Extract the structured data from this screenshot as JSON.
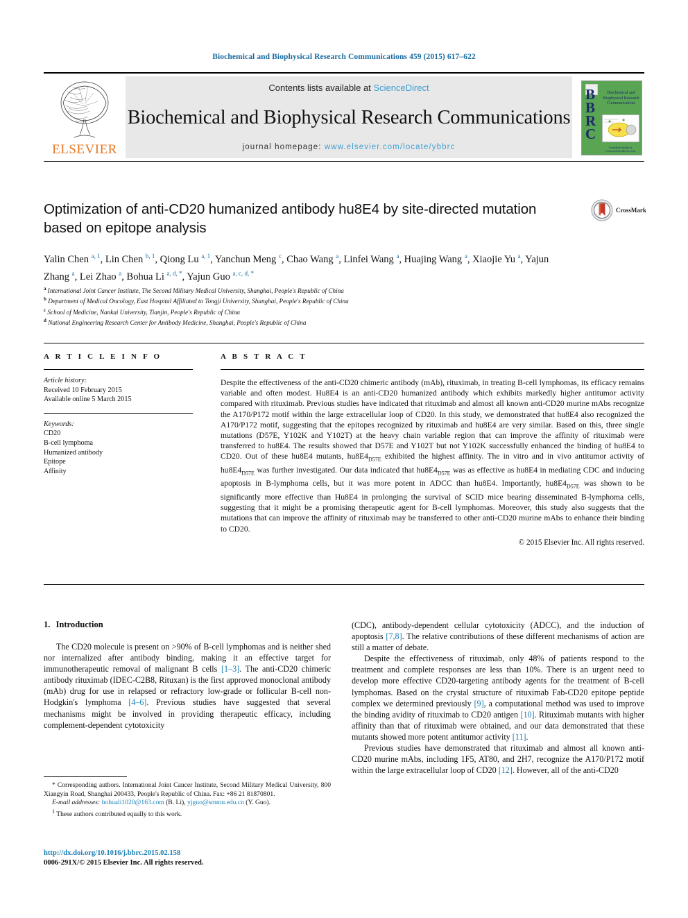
{
  "running_head": "Biochemical and Biophysical Research Communications 459 (2015) 617–622",
  "masthead": {
    "publisher": "ELSEVIER",
    "contents_prefix": "Contents lists available at ",
    "contents_link": "ScienceDirect",
    "journal_title": "Biochemical and Biophysical Research Communications",
    "homepage_prefix": "journal homepage: ",
    "homepage_url": "www.elsevier.com/locate/ybbrc",
    "cover": {
      "letters": "BBRC",
      "journal_name": "Biochemical and Biophysical Research Communications",
      "footer": "Available online at www.sciencedirect.com"
    }
  },
  "article": {
    "title": "Optimization of anti-CD20 humanized antibody hu8E4 by site-directed mutation based on epitope analysis",
    "crossmark_label": "CrossMark",
    "authors": [
      {
        "name": "Yalin Chen",
        "marks": "a, 1",
        "sep": ", "
      },
      {
        "name": "Lin Chen",
        "marks": "b, 1",
        "sep": ", "
      },
      {
        "name": "Qiong Lu",
        "marks": "a, 1",
        "sep": ", "
      },
      {
        "name": "Yanchun Meng",
        "marks": "c",
        "sep": ", "
      },
      {
        "name": "Chao Wang",
        "marks": "a",
        "sep": ", "
      },
      {
        "name": "Linfei Wang",
        "marks": "a",
        "sep": ", "
      },
      {
        "name": "Huajing Wang",
        "marks": "a",
        "sep": ", "
      },
      {
        "name": "Xiaojie Yu",
        "marks": "a",
        "sep": ", "
      },
      {
        "name": "Yajun Zhang",
        "marks": "a",
        "sep": ", "
      },
      {
        "name": "Lei Zhao",
        "marks": "a",
        "sep": ", "
      },
      {
        "name": "Bohua Li",
        "marks": "a, d, *",
        "sep": ", "
      },
      {
        "name": "Yajun Guo",
        "marks": "a, c, d, *",
        "sep": ""
      }
    ],
    "affiliations": [
      {
        "mark": "a",
        "text": "International Joint Cancer Institute, The Second Military Medical University, Shanghai, People's Republic of China"
      },
      {
        "mark": "b",
        "text": "Department of Medical Oncology, East Hospital Affiliated to Tongji University, Shanghai, People's Republic of China"
      },
      {
        "mark": "c",
        "text": "School of Medicine, Nankai University, Tianjin, People's Republic of China"
      },
      {
        "mark": "d",
        "text": "National Engineering Research Center for Antibody Medicine, Shanghai, People's Republic of China"
      }
    ]
  },
  "article_info": {
    "heading": "A R T I C L E    I N F O",
    "history_label": "Article history:",
    "history": [
      "Received 10 February 2015",
      "Available online 5 March 2015"
    ],
    "keywords_label": "Keywords:",
    "keywords": [
      "CD20",
      "B-cell lymphoma",
      "Humanized antibody",
      "Epitope",
      "Affinity"
    ]
  },
  "abstract": {
    "heading": "A B S T R A C T",
    "paragraph_1": "Despite the effectiveness of the anti-CD20 chimeric antibody (mAb), rituximab, in treating B-cell lymphomas, its efficacy remains variable and often modest. Hu8E4 is an anti-CD20 humanized antibody which exhibits markedly higher antitumor activity compared with rituximab. Previous studies have indicated that rituximab and almost all known anti-CD20 murine mAbs recognize the A170/P172 motif within the large extracellular loop of CD20. In this study, we demonstrated that hu8E4 also recognized the A170/P172 motif, suggesting that the epitopes recognized by rituximab and hu8E4 are very similar. Based on this, three single mutations (D57E, Y102K and Y102T) at the heavy chain variable region that can improve the affinity of rituximab were transferred to hu8E4. The results showed that D57E and Y102T but not Y102K successfully enhanced the binding of hu8E4 to CD20. Out of these hu8E4 mutants, hu8E4",
    "subscript": "D57E",
    "paragraph_1b": " exhibited the highest affinity. The in vitro and in vivo antitumor activity of hu8E4",
    "paragraph_1c": " was further investigated. Our data indicated that hu8E4",
    "paragraph_1d": " was as effective as hu8E4 in mediating CDC and inducing apoptosis in B-lymphoma cells, but it was more potent in ADCC than hu8E4. Importantly, hu8E4",
    "paragraph_1e": " was shown to be significantly more effective than Hu8E4 in prolonging the survival of SCID mice bearing disseminated B-lymphoma cells, suggesting that it might be a promising therapeutic agent for B-cell lymphomas. Moreover, this study also suggests that the mutations that can improve the affinity of rituximab may be transferred to other anti-CD20 murine mAbs to enhance their binding to CD20.",
    "copyright": "© 2015 Elsevier Inc. All rights reserved."
  },
  "body": {
    "section_number": "1.",
    "section_title": "Introduction",
    "left_p1_a": "The CD20 molecule is present on >90% of B-cell lymphomas and is neither shed nor internalized after antibody binding, making it an effective target for immunotherapeutic removal of malignant B cells ",
    "left_p1_ref1": "[1–3]",
    "left_p1_b": ". The anti-CD20 chimeric antibody rituximab (IDEC-C2B8, Rituxan) is the first approved monoclonal antibody (mAb) drug for use in relapsed or refractory low-grade or follicular B-cell non-Hodgkin's lymphoma ",
    "left_p1_ref2": "[4–6]",
    "left_p1_c": ". Previous studies have suggested that several mechanisms might be involved in providing therapeutic efficacy, including complement-dependent cytotoxicity",
    "right_p1_a": "(CDC), antibody-dependent cellular cytotoxicity (ADCC), and the induction of apoptosis ",
    "right_p1_ref": "[7,8]",
    "right_p1_b": ". The relative contributions of these different mechanisms of action are still a matter of debate.",
    "right_p2_a": "Despite the effectiveness of rituximab, only 48% of patients respond to the treatment and complete responses are less than 10%. There is an urgent need to develop more effective CD20-targeting antibody agents for the treatment of B-cell lymphomas. Based on the crystal structure of rituximab Fab-CD20 epitope peptide complex we determined previously ",
    "right_p2_ref1": "[9]",
    "right_p2_b": ", a computational method was used to improve the binding avidity of rituximab to CD20 antigen ",
    "right_p2_ref2": "[10]",
    "right_p2_c": ". Rituximab mutants with higher affinity than that of rituximab were obtained, and our data demonstrated that these mutants showed more potent antitumor activity ",
    "right_p2_ref3": "[11]",
    "right_p2_d": ".",
    "right_p3_a": "Previous studies have demonstrated that rituximab and almost all known anti-CD20 murine mAbs, including 1F5, AT80, and 2H7, recognize the A170/P172 motif within the large extracellular loop of CD20 ",
    "right_p3_ref": "[12]",
    "right_p3_b": ". However, all of the anti-CD20"
  },
  "footnotes": {
    "corresponding_a": "* Corresponding authors. International Joint Cancer Institute, Second Military Medical University, 800 Xiangyin Road, Shanghai 200433, People's Republic of China. Fax: +86 21 81870801.",
    "email_label": "E-mail addresses:",
    "email_1": "bohuali1020@163.com",
    "email_1_who": " (B. Li), ",
    "email_2": "yjguo@smmu.edu.cn",
    "email_2_who": " (Y. Guo).",
    "equal_note_mark": "1",
    "equal_note": " These authors contributed equally to this work."
  },
  "footer": {
    "doi": "http://dx.doi.org/10.1016/j.bbrc.2015.02.158",
    "issn_line": "0006-291X/© 2015 Elsevier Inc. All rights reserved."
  }
}
